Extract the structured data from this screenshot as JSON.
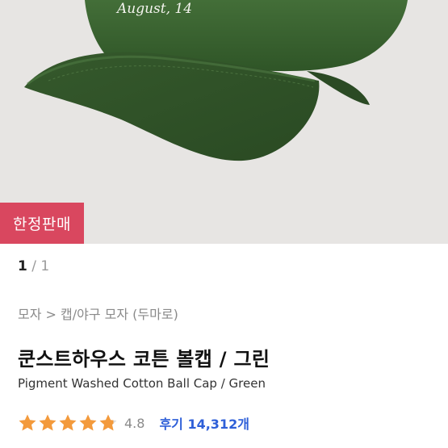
{
  "hero": {
    "cap_color": "#3d6633",
    "embroidery_text": "August, 14",
    "badge_label": "한정판매",
    "badge_color": "#d9475f"
  },
  "pager": {
    "current": "1",
    "separator": "/",
    "total": "1"
  },
  "breadcrumb": "모자 > 캡/야구 모자 (두마로)",
  "product": {
    "title": "쿤스트하우스 코튼 볼캡 / 그린",
    "subtitle": "Pigment Washed Cotton Ball Cap / Green"
  },
  "rating": {
    "score": "4.8",
    "stars_value": 4.8,
    "star_color": "#f39a3c",
    "reviews_label": "후기 14,312개"
  }
}
